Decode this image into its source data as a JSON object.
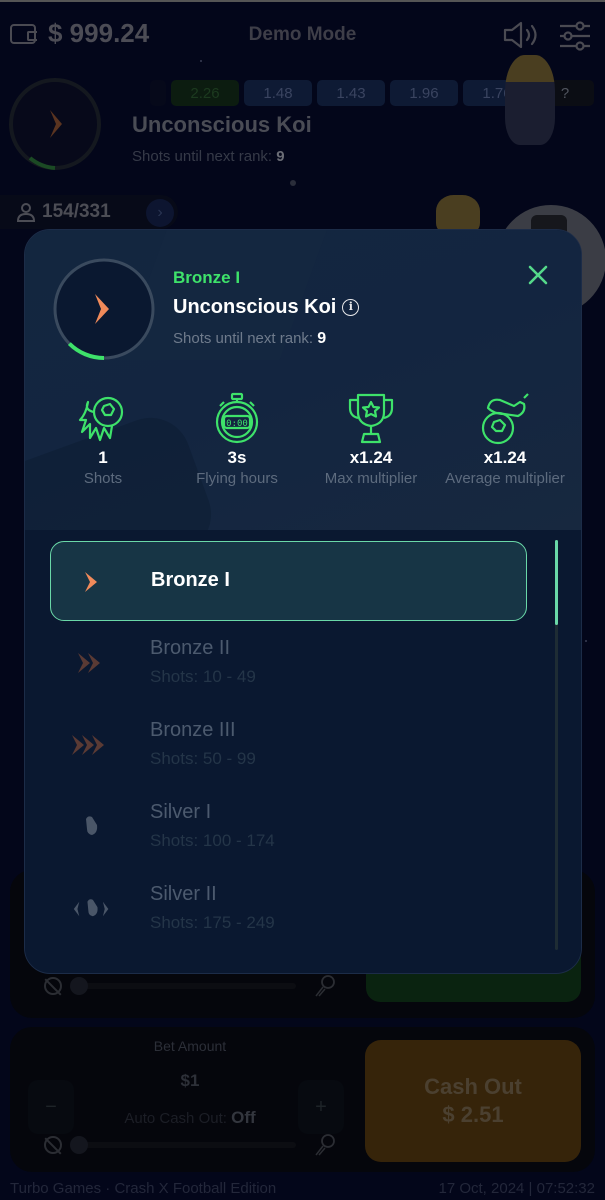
{
  "header": {
    "balance": "$ 999.24",
    "mode": "Demo Mode"
  },
  "background_rank": {
    "name": "Unconscious Koi",
    "next_rank_label": "Shots until next rank:",
    "next_rank_value": "9"
  },
  "multipliers": [
    "2.26",
    "1.48",
    "1.43",
    "1.96",
    "1.76",
    "?"
  ],
  "players": {
    "count": "154/331",
    "more_glyph": "›"
  },
  "bet_panel": {
    "bet_amount_label": "Bet Amount",
    "bet_amount_value": "$1",
    "minus_glyph": "−",
    "plus_glyph": "+",
    "auto_cashout_label": "Auto Cash Out:",
    "auto_cashout_value": "Off",
    "cash_out_label": "Cash Out",
    "cash_out_amount": "$ 2.51"
  },
  "footer": {
    "left": "Turbo Games · Crash X Football Edition",
    "right": "17 Oct, 2024 | 07:52:32"
  },
  "modal": {
    "rank_tier": "Bronze I",
    "user_name": "Unconscious Koi",
    "info_glyph": "i",
    "next_rank_label": "Shots until next rank:",
    "next_rank_value": "9",
    "rank_progress": 0.1,
    "accent_color": "#3ee26a",
    "stats": [
      {
        "icon": "fire-ball-icon",
        "value": "1",
        "label": "Shots"
      },
      {
        "icon": "stopwatch-icon",
        "value": "3s",
        "label": "Flying hours"
      },
      {
        "icon": "trophy-icon",
        "value": "x1.24",
        "label": "Max multiplier"
      },
      {
        "icon": "boot-ball-icon",
        "value": "x1.24",
        "label": "Average multiplier"
      }
    ],
    "ranks": [
      {
        "title": "Bronze I",
        "shots": "",
        "active": true,
        "badge": "bronze-1-icon"
      },
      {
        "title": "Bronze II",
        "shots": "Shots: 10 - 49",
        "active": false,
        "badge": "bronze-2-icon"
      },
      {
        "title": "Bronze III",
        "shots": "Shots: 50 - 99",
        "active": false,
        "badge": "bronze-3-icon"
      },
      {
        "title": "Silver I",
        "shots": "Shots: 100 - 174",
        "active": false,
        "badge": "silver-1-icon"
      },
      {
        "title": "Silver II",
        "shots": "Shots: 175 - 249",
        "active": false,
        "badge": "silver-2-icon"
      }
    ]
  }
}
